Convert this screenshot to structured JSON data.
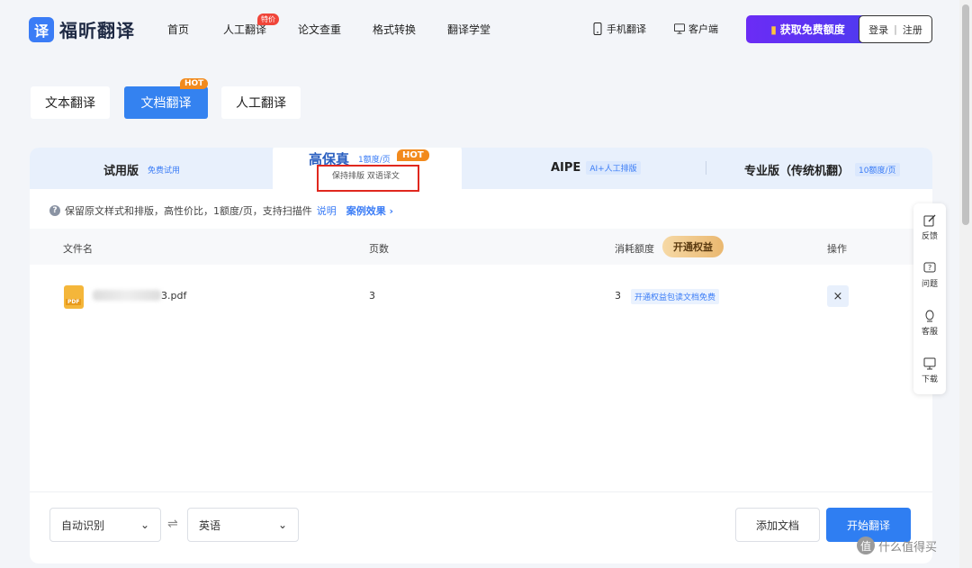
{
  "brand": {
    "logo_char": "译",
    "name": "福昕翻译"
  },
  "nav": {
    "items": [
      "首页",
      "人工翻译",
      "论文查重",
      "格式转换",
      "翻译学堂"
    ],
    "badge": "特价",
    "mobile": "手机翻译",
    "desktop": "客户端",
    "quota_btn": "获取免费额度",
    "login": "登录",
    "register": "注册"
  },
  "mode_tabs": [
    "文本翻译",
    "文档翻译",
    "人工翻译"
  ],
  "hot": "HOT",
  "tiers": {
    "trial": {
      "label": "试用版",
      "sub": "免费试用"
    },
    "hifi": {
      "label": "高保真",
      "sub": "1额度/页",
      "desc": "保持排版 双语译文"
    },
    "aipe": {
      "label": "AIPE",
      "sub": "AI+人工排版"
    },
    "pro": {
      "label": "专业版（传统机翻）",
      "sub": "10额度/页"
    }
  },
  "info": {
    "text": "保留原文样式和排版，高性价比，1额度/页，支持扫描件",
    "explain": "说明",
    "case": "案例效果"
  },
  "table": {
    "headers": [
      "文件名",
      "页数",
      "消耗额度",
      "操作"
    ],
    "unlock": "开通权益",
    "rows": [
      {
        "file_suffix": "3.pdf",
        "pages": "3",
        "cost": "3",
        "tag": "开通权益包读文档免费",
        "delete": "×"
      }
    ]
  },
  "pdf_label": "PDF",
  "lang": {
    "source": "自动识别",
    "target": "英语"
  },
  "actions": {
    "add": "添加文档",
    "start": "开始翻译"
  },
  "side": [
    "反馈",
    "问题",
    "客服",
    "下载"
  ],
  "watermark": {
    "char": "值",
    "text": "什么值得买"
  }
}
